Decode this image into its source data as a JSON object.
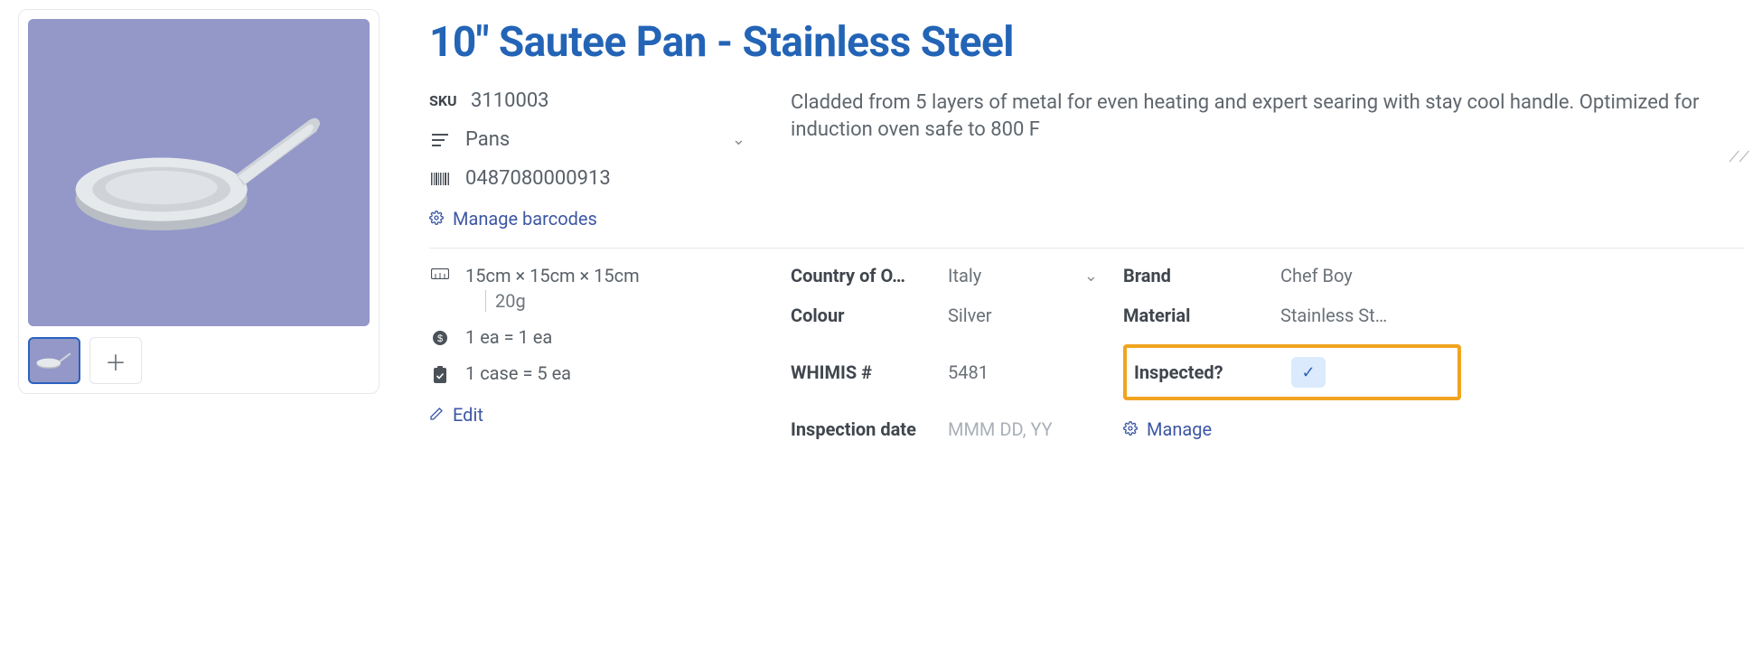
{
  "title": "10\" Sautee Pan - Stainless Steel",
  "sku": {
    "label": "SKU",
    "value": "3110003"
  },
  "category": "Pans",
  "barcode": "0487080000913",
  "manage_barcodes": "Manage barcodes",
  "description": "Cladded from 5 layers of metal for even heating and expert searing with stay cool handle. Optimized for induction oven safe to 800 F",
  "dimensions": {
    "text": "15cm × 15cm × 15cm",
    "weight": "20g"
  },
  "unit_eq": "1 ea = 1 ea",
  "case_eq": "1 case = 5 ea",
  "edit": "Edit",
  "attrs": {
    "country": {
      "label": "Country of O…",
      "value": "Italy"
    },
    "brand": {
      "label": "Brand",
      "value": "Chef Boy"
    },
    "colour": {
      "label": "Colour",
      "value": "Silver"
    },
    "material": {
      "label": "Material",
      "value": "Stainless St…"
    },
    "whimis": {
      "label": "WHIMIS #",
      "value": "5481"
    },
    "inspected": {
      "label": "Inspected?"
    },
    "inspection_date": {
      "label": "Inspection date",
      "placeholder": "MMM DD, YY"
    },
    "manage": "Manage"
  }
}
